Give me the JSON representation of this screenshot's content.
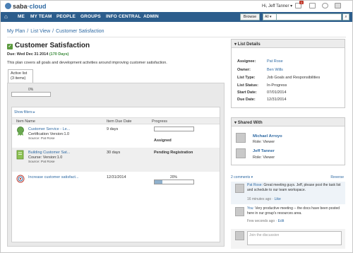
{
  "header": {
    "logo_text": "saba",
    "logo_suffix": "cloud",
    "user_greeting": "Hi, Jeff Tanner",
    "message_badge": "1",
    "nav_items": [
      "ME",
      "MY TEAM",
      "PEOPLE",
      "GROUPS",
      "INFO CENTRAL",
      "ADMIN"
    ],
    "browse_label": "Browse",
    "search_scope": "All"
  },
  "breadcrumb": [
    "My Plan",
    "List View",
    "Customer Satisfaction"
  ],
  "page": {
    "title": "Customer Satisfaction",
    "due_label": "Due: Wed Dec 31 2014",
    "due_days": "(170 Days)",
    "description": "This plan covers all goals and development activities around improving customer satisfaction.",
    "tab_label": "Active list",
    "tab_count": "(3 items)",
    "overall_progress_label": "0%",
    "overall_progress": 0,
    "show_filters": "Show filters ▸"
  },
  "table": {
    "columns": [
      "Item Name",
      "Item Due Date",
      "Progress"
    ],
    "rows": [
      {
        "name": "Customer Service - Le...",
        "type": "Certification",
        "version": "Version:1.0",
        "source": "Source: Pat Rose",
        "due": "9 days",
        "progress_label": "0%",
        "progress": 0,
        "status": "Assigned"
      },
      {
        "name": "Building Customer Sat...",
        "type": "Course:",
        "version": "Version:1.0",
        "source": "Source: Pat Rose",
        "due": "30 days",
        "status": "Pending Registration"
      },
      {
        "name": "Increase customer satisfact...",
        "due": "12/31/2014",
        "progress_label": "20%",
        "progress": 20
      }
    ]
  },
  "list_details": {
    "heading": "List Details",
    "fields": [
      {
        "label": "Assignee:",
        "value": "Pat Rose"
      },
      {
        "label": "Owner:",
        "value": "Ben Wills"
      },
      {
        "label": "List Type:",
        "value": "Job Goals and Responsibilities"
      },
      {
        "label": "List Status:",
        "value": "In-Progress"
      },
      {
        "label": "Start Date:",
        "value": "07/01/2014"
      },
      {
        "label": "Due Date:",
        "value": "12/31/2014"
      }
    ]
  },
  "shared_with": {
    "heading": "Shared With",
    "people": [
      {
        "name": "Michael Arroyo",
        "role": "Role: Viewer"
      },
      {
        "name": "Jeff Tanner",
        "role": "Role: Viewer"
      }
    ]
  },
  "comments": {
    "count_label": "2 comments ▾",
    "reverse_label": "Reverse",
    "items": [
      {
        "author": "Pat Rose:",
        "text": "Great meeting guys. Jeff, please post the task list and schedule to our team workspace.",
        "time": "16 minutes ago",
        "action": "Like"
      },
      {
        "author": "You:",
        "text": "Very productive meeting -- the docs have been posted here in our group's resources area.",
        "time": "Few seconds ago",
        "action": "Edit"
      }
    ],
    "join_placeholder": "Join the discussion"
  },
  "colors": {
    "nav_bg": "#2c5d8c",
    "link": "#2f6aa3",
    "due_days": "#3a8a3a"
  }
}
